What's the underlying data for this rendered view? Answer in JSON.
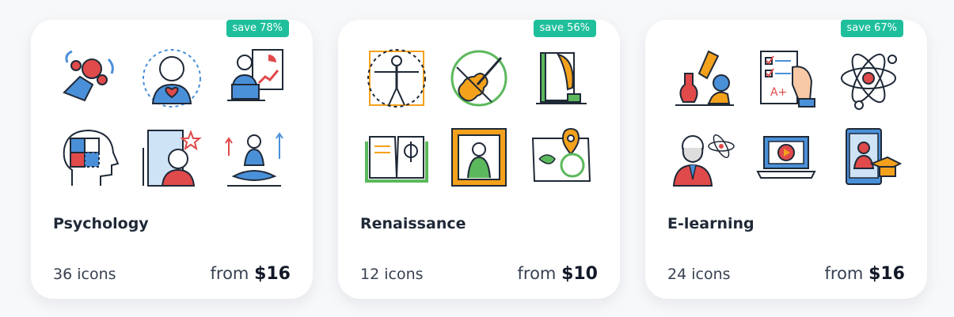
{
  "cards": [
    {
      "title": "Psychology",
      "badge": "save 78%",
      "count": "36 icons",
      "price_prefix": "from",
      "price": "$16",
      "icons": [
        "fidget-spinner-hand-icon",
        "woman-heart-icon",
        "presenter-laptop-chart-icon",
        "puzzle-head-icon",
        "boy-mirror-icon",
        "meditation-icon"
      ]
    },
    {
      "title": "Renaissance",
      "badge": "save 56%",
      "count": "12 icons",
      "price_prefix": "from",
      "price": "$10",
      "icons": [
        "vitruvian-man-icon",
        "violin-icon",
        "book-quill-icon",
        "open-book-phi-icon",
        "mona-lisa-painting-icon",
        "map-pin-globe-icon"
      ]
    },
    {
      "title": "E-learning",
      "badge": "save 67%",
      "count": "24 icons",
      "price_prefix": "from",
      "price": "$16",
      "icons": [
        "microscope-flask-icon",
        "test-paper-a-plus-icon",
        "atom-icon",
        "professor-atom-icon",
        "laptop-video-play-icon",
        "tablet-graduate-icon"
      ]
    }
  ],
  "colors": {
    "accent_green": "#1fbf9c",
    "icon_blue": "#2f6fb5",
    "icon_red": "#e04a4a",
    "icon_orange": "#f4a11c",
    "icon_green": "#5cb85c"
  }
}
